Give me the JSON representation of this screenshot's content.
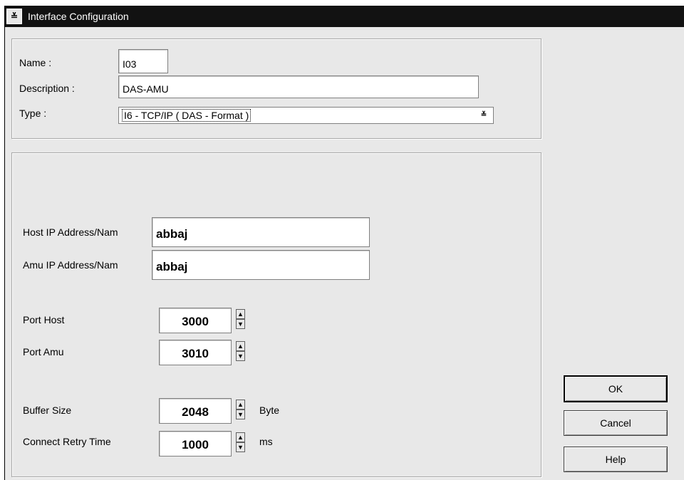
{
  "window": {
    "title": "Interface Configuration",
    "sysmenu_glyph": "≚"
  },
  "general": {
    "name_label": "Name :",
    "name_value": "I03",
    "description_label": "Description :",
    "description_value": "DAS-AMU",
    "type_label": "Type :",
    "type_value": "I6  -  TCP/IP ( DAS - Format )",
    "type_arrow_glyph": "≚"
  },
  "settings": {
    "host_ip_label": "Host IP Address/Nam",
    "host_ip_value": "abbaj",
    "amu_ip_label": "Amu IP Address/Nam",
    "amu_ip_value": "abbaj",
    "port_host_label": "Port Host",
    "port_host_value": "3000",
    "port_amu_label": "Port Amu",
    "port_amu_value": "3010",
    "buffer_size_label": "Buffer Size",
    "buffer_size_value": "2048",
    "buffer_size_unit": "Byte",
    "retry_label": "Connect Retry Time",
    "retry_value": "1000",
    "retry_unit": "ms",
    "spin_up_glyph": "▲",
    "spin_down_glyph": "▼"
  },
  "buttons": {
    "ok": "OK",
    "cancel": "Cancel",
    "help": "Help"
  }
}
